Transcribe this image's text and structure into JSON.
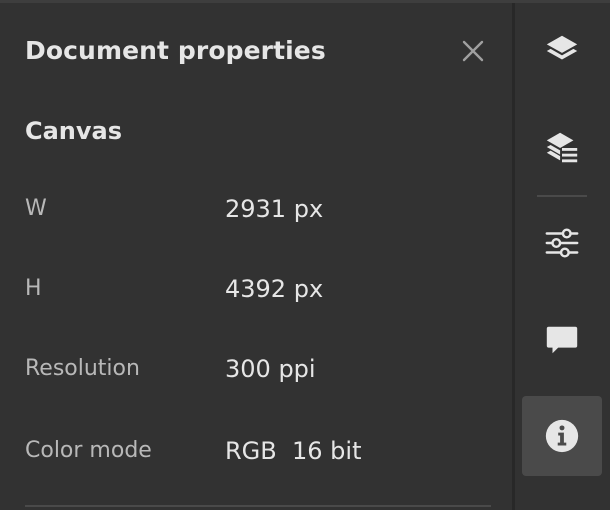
{
  "panel": {
    "title": "Document properties",
    "close_icon": "close-icon",
    "section_title": "Canvas",
    "properties": [
      {
        "label": "W",
        "value": "2931 px"
      },
      {
        "label": "H",
        "value": "4392 px"
      },
      {
        "label": "Resolution",
        "value": "300 ppi"
      },
      {
        "label": "Color mode",
        "value": "RGB  16 bit"
      }
    ]
  },
  "rail": {
    "items": [
      {
        "icon": "layers-icon",
        "active": false
      },
      {
        "icon": "layer-properties-icon",
        "active": false
      },
      {
        "icon": "adjustments-sliders-icon",
        "active": false
      },
      {
        "icon": "comments-icon",
        "active": false
      },
      {
        "icon": "info-icon",
        "active": true
      }
    ]
  },
  "colors": {
    "background": "#323232",
    "text_primary": "#e6e6e6",
    "text_secondary": "#b8b8b8",
    "active_button": "#4a4a4a",
    "divider": "#282828"
  }
}
